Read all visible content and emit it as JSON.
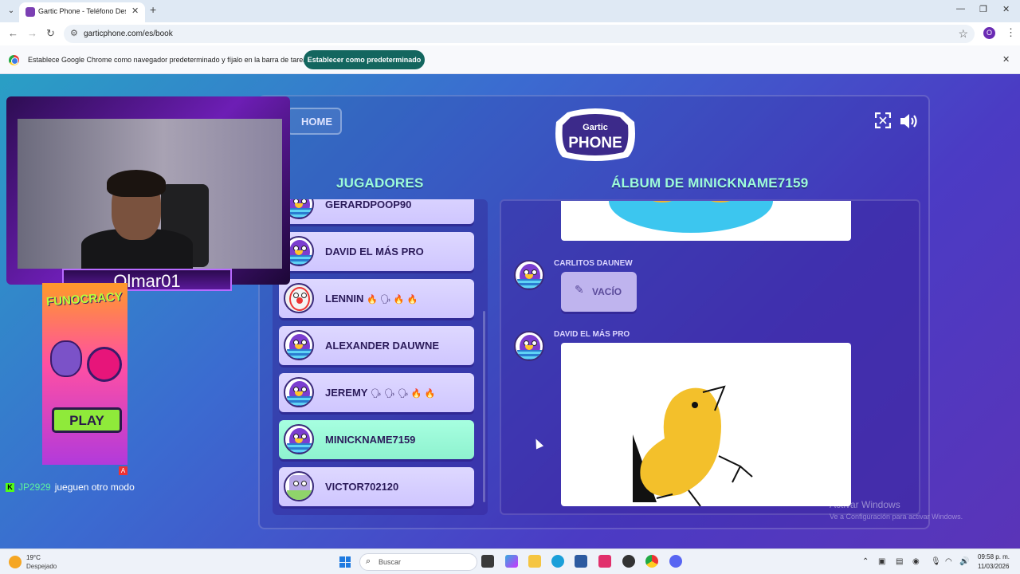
{
  "browser": {
    "tab_title": "Gartic Phone - Teléfono Descon",
    "url": "garticphone.com/es/book",
    "profile_initial": "O",
    "infobar_text": "Establece Google Chrome como navegador predeterminado y fíjalo en la barra de tareas",
    "infobar_button": "Establecer como predeterminado"
  },
  "game": {
    "home_label": "HOME",
    "players_heading": "JUGADORES",
    "album_heading": "ÁLBUM DE MINICKNAME7159",
    "players": [
      {
        "name": "GERARDPOOP90",
        "emoji": ""
      },
      {
        "name": "DAVID EL MÁS PRO",
        "emoji": ""
      },
      {
        "name": "LENNIN",
        "emoji": "🔥 🗣 🔥 🔥"
      },
      {
        "name": "ALEXANDER DAUWNE",
        "emoji": ""
      },
      {
        "name": "JEREMY",
        "emoji": "🗣 🗣 🗣 🔥 🔥"
      },
      {
        "name": "MINICKNAME7159",
        "emoji": ""
      },
      {
        "name": "VICTOR702120",
        "emoji": ""
      }
    ],
    "album": {
      "entry1_author": "CARLITOS DAUNEW",
      "entry1_status": "VACÍO",
      "entry2_author": "DAVID EL MÁS PRO"
    },
    "watermark_title": "Activar Windows",
    "watermark_sub": "Ve a Configuración para activar Windows."
  },
  "overlay": {
    "streamer": "Olmar01",
    "ad_title": "FUNOCRACY",
    "ad_play": "PLAY",
    "chat_user": "JP2929",
    "chat_message": "jueguen otro modo"
  },
  "taskbar": {
    "weather_temp": "19°C",
    "weather_desc": "Despejado",
    "search_placeholder": "Buscar",
    "time": "09:58 p. m.",
    "date": "11/03/2026"
  }
}
